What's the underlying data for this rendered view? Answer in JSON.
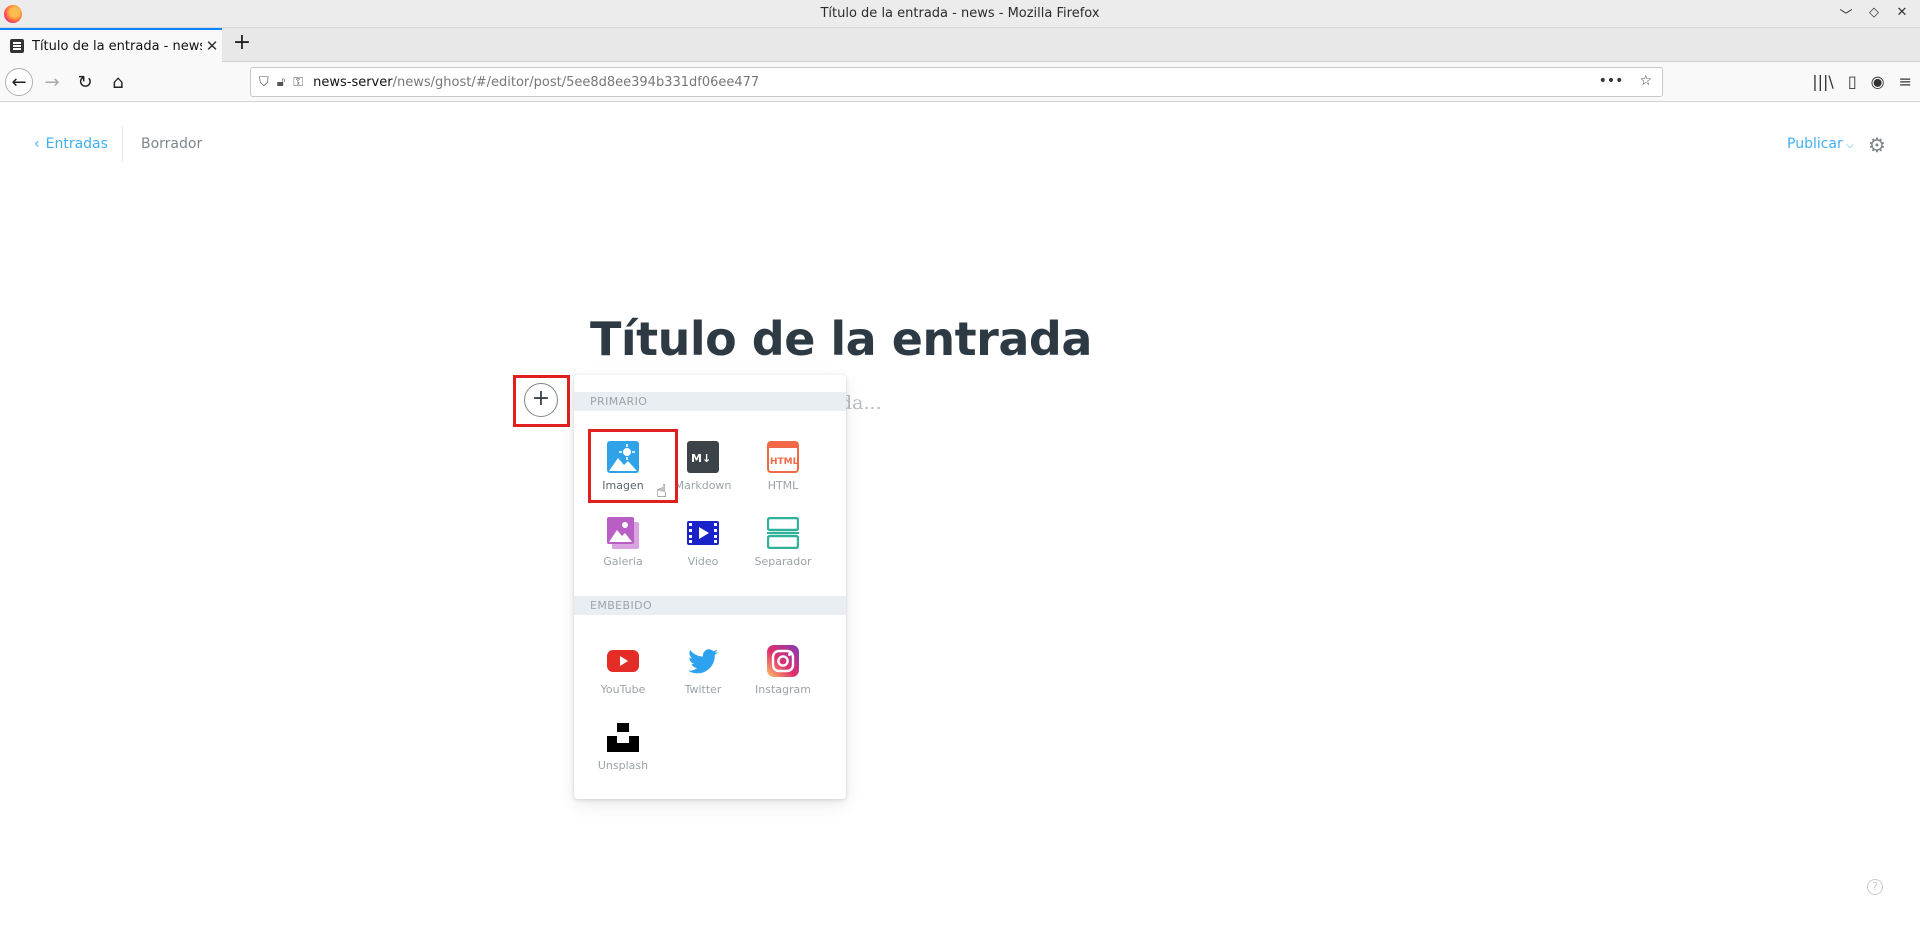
{
  "window": {
    "title": "Título de la entrada - news - Mozilla Firefox",
    "controls": [
      "﹀",
      "◇",
      "✕"
    ]
  },
  "tab": {
    "label": "Título de la entrada - news",
    "close": "✕",
    "new_tab": "+"
  },
  "nav": {
    "back": "←",
    "forward": "→",
    "reload": "↻",
    "home": "⌂",
    "url_host": "news-server",
    "url_path": "/news/ghost/#/editor/post/5ee8d8ee394b331df06ee477",
    "more": "•••",
    "bookmark": "☆",
    "toolbar_icons": [
      "|||\\",
      "▯",
      "◉",
      "≡"
    ]
  },
  "editor": {
    "back_label": "Entradas",
    "status": "Borrador",
    "publish_label": "Publicar",
    "post_title": "Título de la entrada",
    "body_placeholder": "da...",
    "plus_symbol": "+",
    "help_symbol": "?"
  },
  "card_menu": {
    "primary_header": "PRIMARIO",
    "embed_header": "EMBEBIDO",
    "primary_items": [
      {
        "label": "Imagen",
        "icon": "image-icon",
        "color": "#2fa2e8"
      },
      {
        "label": "Markdown",
        "icon": "markdown-icon",
        "color": "#3c4348"
      },
      {
        "label": "HTML",
        "icon": "html-icon",
        "color": "#f26846"
      },
      {
        "label": "Galeria",
        "icon": "gallery-icon",
        "color": "#b95ec4"
      },
      {
        "label": "Video",
        "icon": "video-icon",
        "color": "#1a22c9"
      },
      {
        "label": "Separador",
        "icon": "divider-icon",
        "color": "#30b29a"
      }
    ],
    "embed_items": [
      {
        "label": "YouTube",
        "icon": "youtube-icon",
        "color": "#e52d27"
      },
      {
        "label": "Twitter",
        "icon": "twitter-icon",
        "color": "#2da2ef"
      },
      {
        "label": "Instagram",
        "icon": "instagram-icon",
        "color": "#d6249f"
      },
      {
        "label": "Unsplash",
        "icon": "unsplash-icon",
        "color": "#000000"
      }
    ]
  }
}
